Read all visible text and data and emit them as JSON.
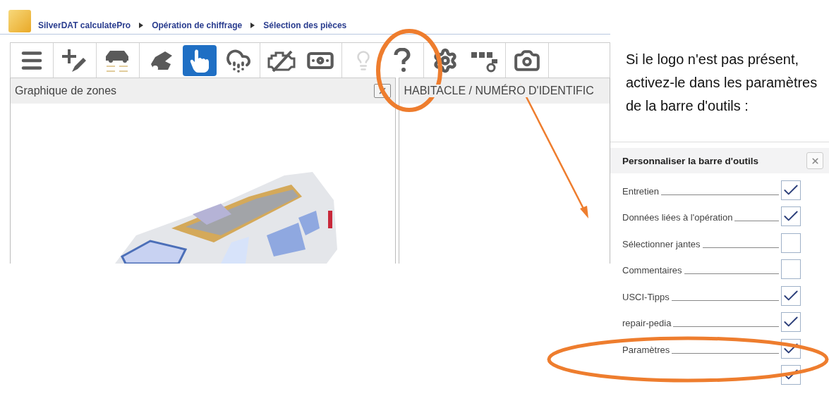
{
  "breadcrumb": [
    "SilverDAT calculatePro",
    "Opération de chiffrage",
    "Sélection des pièces"
  ],
  "toolbar": [
    [
      {
        "kind": "menu",
        "selected": false,
        "disabled": false
      }
    ],
    [
      {
        "kind": "add",
        "selected": false,
        "disabled": false
      }
    ],
    [
      {
        "kind": "parts",
        "selected": false,
        "disabled": false
      }
    ],
    [
      {
        "kind": "hood",
        "selected": false,
        "disabled": false
      },
      {
        "kind": "hand",
        "selected": true,
        "disabled": false
      },
      {
        "kind": "hail",
        "selected": false,
        "disabled": false
      }
    ],
    [
      {
        "kind": "engine",
        "selected": false,
        "disabled": false
      },
      {
        "kind": "money",
        "selected": false,
        "disabled": false
      }
    ],
    [
      {
        "kind": "bulb",
        "selected": false,
        "disabled": true
      },
      {
        "kind": "help",
        "selected": false,
        "disabled": false
      }
    ],
    [
      {
        "kind": "gear",
        "selected": false,
        "disabled": false
      },
      {
        "kind": "custom",
        "selected": false,
        "disabled": false
      }
    ],
    [
      {
        "kind": "camera",
        "selected": false,
        "disabled": false
      }
    ]
  ],
  "left_panel": {
    "title": "Graphique de zones"
  },
  "right_panel": {
    "title": "HABITACLE / NUMÉRO D'IDENTIFIC"
  },
  "instruction": "Si le logo n'est pas présent, activez-le dans les paramètres de la barre d'outils :",
  "dialog": {
    "title": "Personnaliser la barre d'outils",
    "items": [
      {
        "label": "Entretien",
        "checked": true
      },
      {
        "label": "Données liées à l'opération",
        "checked": true
      },
      {
        "label": "Sélectionner jantes",
        "checked": false
      },
      {
        "label": "Commentaires",
        "checked": false
      },
      {
        "label": "USCI-Tipps",
        "checked": true
      },
      {
        "label": "repair-pedia",
        "checked": true
      },
      {
        "label": "Paramètres",
        "checked": true
      },
      {
        "checked": true
      }
    ]
  }
}
